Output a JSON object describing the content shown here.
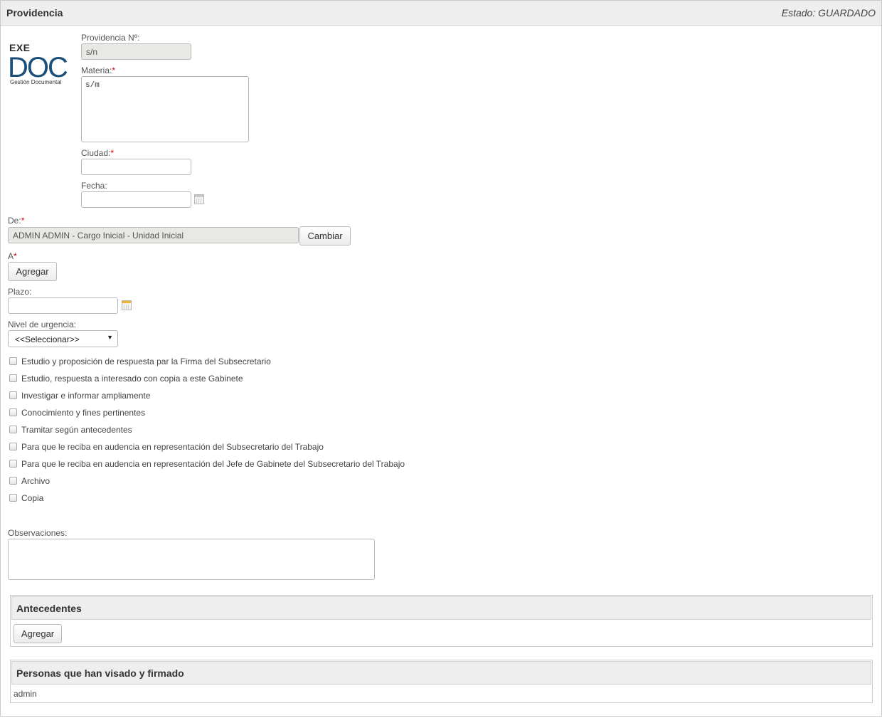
{
  "header": {
    "title": "Providencia",
    "status": "Estado: GUARDADO"
  },
  "logo": {
    "top_text": "EXE",
    "main_text": "DOC",
    "subtitle": "Gestión Documental",
    "color": "#1a4f7a"
  },
  "form": {
    "providencia_label": "Providencia Nº:",
    "providencia_value": "s/n",
    "materia_label": "Materia:",
    "materia_value": "s/m",
    "ciudad_label": "Ciudad:",
    "ciudad_value": "",
    "fecha_label": "Fecha:",
    "fecha_value": "",
    "de_label": "De:",
    "de_value": "ADMIN ADMIN - Cargo Inicial - Unidad Inicial",
    "cambiar_label": "Cambiar",
    "a_label": "A",
    "agregar_label": "Agregar",
    "plazo_label": "Plazo:",
    "plazo_value": "",
    "urgencia_label": "Nivel de urgencia:",
    "urgencia_value": "<<Seleccionar>>",
    "required_mark": "*",
    "observaciones_label": "Observaciones:",
    "observaciones_value": ""
  },
  "checkboxes": [
    "Estudio y proposición de respuesta par la Firma del Subsecretario",
    "Estudio, respuesta a interesado con copia a este Gabinete",
    "Investigar e informar ampliamente",
    "Conocimiento y fines pertinentes",
    "Tramitar según antecedentes",
    "Para que le reciba en audencia en representación del Subsecretario del Trabajo",
    "Para que le reciba en audencia en representación del Jefe de Gabinete del Subsecretario del Trabajo",
    "Archivo",
    "Copia"
  ],
  "antecedentes": {
    "title": "Antecedentes",
    "button": "Agregar"
  },
  "firmantes": {
    "title": "Personas que han visado y firmado",
    "items": [
      "admin"
    ]
  },
  "colors": {
    "required": "#d00000",
    "header_bg": "#eeeeee",
    "readonly_bg": "#e8e8e4"
  }
}
